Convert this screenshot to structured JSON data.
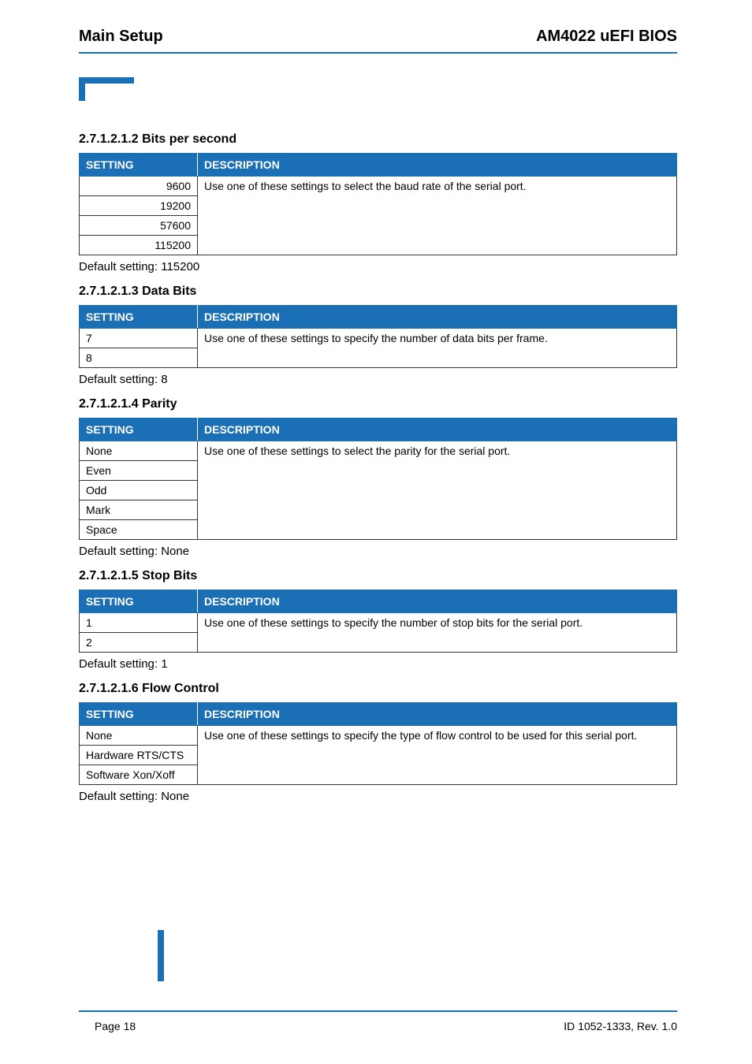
{
  "header": {
    "left": "Main Setup",
    "right": "AM4022 uEFI BIOS"
  },
  "columns": {
    "setting": "SETTING",
    "description": "DESCRIPTION"
  },
  "sections": [
    {
      "heading": "2.7.1.2.1.2  Bits per second",
      "align": "right",
      "settings": [
        "9600",
        "19200",
        "57600",
        "115200"
      ],
      "description": "Use one of these settings to select the baud rate of the serial port.",
      "default": "Default setting: 115200"
    },
    {
      "heading": "2.7.1.2.1.3  Data Bits",
      "align": "left",
      "settings": [
        "7",
        "8"
      ],
      "description": "Use one of these settings to specify the number of data bits per frame.",
      "default": "Default setting: 8"
    },
    {
      "heading": "2.7.1.2.1.4  Parity",
      "align": "left",
      "settings": [
        "None",
        "Even",
        "Odd",
        "Mark",
        "Space"
      ],
      "description": "Use one of these settings to select the parity for the serial port.",
      "default": "Default setting: None"
    },
    {
      "heading": "2.7.1.2.1.5  Stop Bits",
      "align": "left",
      "settings": [
        "1",
        "2"
      ],
      "description": "Use one of these settings to specify the number of stop bits for the serial port.",
      "default": "Default setting: 1"
    },
    {
      "heading": "2.7.1.2.1.6  Flow Control",
      "align": "left",
      "settings": [
        "None",
        "Hardware RTS/CTS",
        "Software Xon/Xoff"
      ],
      "description": "Use one of these settings to specify the type of flow control to be used for this serial port.",
      "default": "Default setting: None"
    }
  ],
  "footer": {
    "left": "Page 18",
    "right": "ID 1052-1333, Rev. 1.0"
  }
}
